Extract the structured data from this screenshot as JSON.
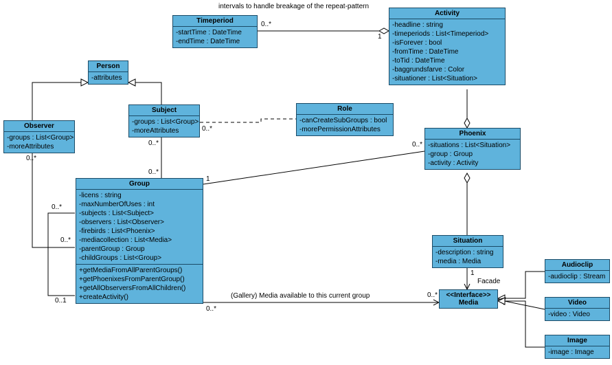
{
  "note_top": "intervals to handle breakage of the repeat-pattern",
  "note_gallery": "(Gallery) Media available to this current group",
  "facade": "Facade",
  "mult": {
    "zero_star": "0..*",
    "one": "1",
    "zero_one": "0..1"
  },
  "classes": {
    "Timeperiod": {
      "title": "Timeperiod",
      "attrs": [
        "-startTime : DateTime",
        "-endTime : DateTime"
      ]
    },
    "Activity": {
      "title": "Activity",
      "attrs": [
        "-headline : string",
        "-timeperiods : List<Timeperiod>",
        "-isForever : bool",
        "-fromTime : DateTime",
        "-toTid : DateTime",
        "-baggrundsfarve : Color",
        "-situationer : List<Situation>"
      ]
    },
    "Person": {
      "title": "Person",
      "attrs": [
        "-attributes"
      ]
    },
    "Observer": {
      "title": "Observer",
      "attrs": [
        "-groups : List<Group>",
        "-moreAttributes"
      ]
    },
    "Subject": {
      "title": "Subject",
      "attrs": [
        "-groups : List<Group>",
        "-moreAttributes"
      ]
    },
    "Role": {
      "title": "Role",
      "attrs": [
        "-canCreateSubGroups : bool",
        "-morePermissionAttributes"
      ]
    },
    "Phoenix": {
      "title": "Phoenix",
      "attrs": [
        "-situations : List<Situation>",
        "-group : Group",
        "-activity : Activity"
      ]
    },
    "Group": {
      "title": "Group",
      "attrs": [
        "-licens : string",
        "-maxNumberOfUses : int",
        "-subjects : List<Subject>",
        "-observers : List<Observer>",
        "-firebirds : List<Phoenix>",
        "-mediacollection : List<Media>",
        "-parentGroup : Group",
        "-childGroups : List<Group>"
      ],
      "ops": [
        "+getMediaFromAllParentGroups()",
        "+getPhoenixesFromParentGroup()",
        "+getAllObserversFromAllChildren()",
        "+createActivity()"
      ]
    },
    "Situation": {
      "title": "Situation",
      "attrs": [
        "-description : string",
        "-media : Media"
      ]
    },
    "Media": {
      "stereo": "<<Interface>>",
      "title": "Media"
    },
    "Audioclip": {
      "title": "Audioclip",
      "attrs": [
        "-audioclip : Stream"
      ]
    },
    "Video": {
      "title": "Video",
      "attrs": [
        "-video : Video"
      ]
    },
    "Image": {
      "title": "Image",
      "attrs": [
        "-image : Image"
      ]
    }
  }
}
